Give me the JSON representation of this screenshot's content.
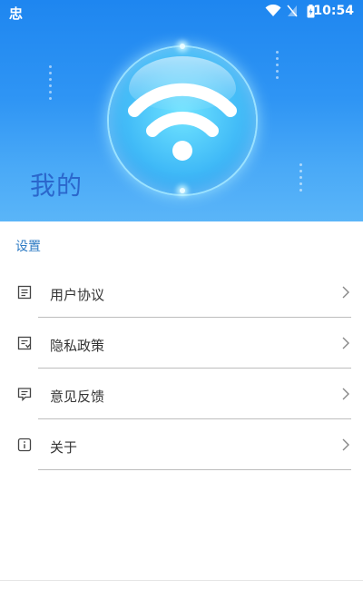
{
  "status_bar": {
    "app_glyph": "忠",
    "time": "10:54"
  },
  "header": {
    "title": "我的"
  },
  "settings": {
    "section_title": "设置",
    "items": [
      {
        "label": "用户协议",
        "icon": "document-icon"
      },
      {
        "label": "隐私政策",
        "icon": "privacy-document-icon"
      },
      {
        "label": "意见反馈",
        "icon": "feedback-icon"
      },
      {
        "label": "关于",
        "icon": "info-icon"
      }
    ]
  },
  "colors": {
    "header_blue": "#1e86f0",
    "title_blue": "#2b67cc",
    "section_blue": "#2d7bc4"
  }
}
